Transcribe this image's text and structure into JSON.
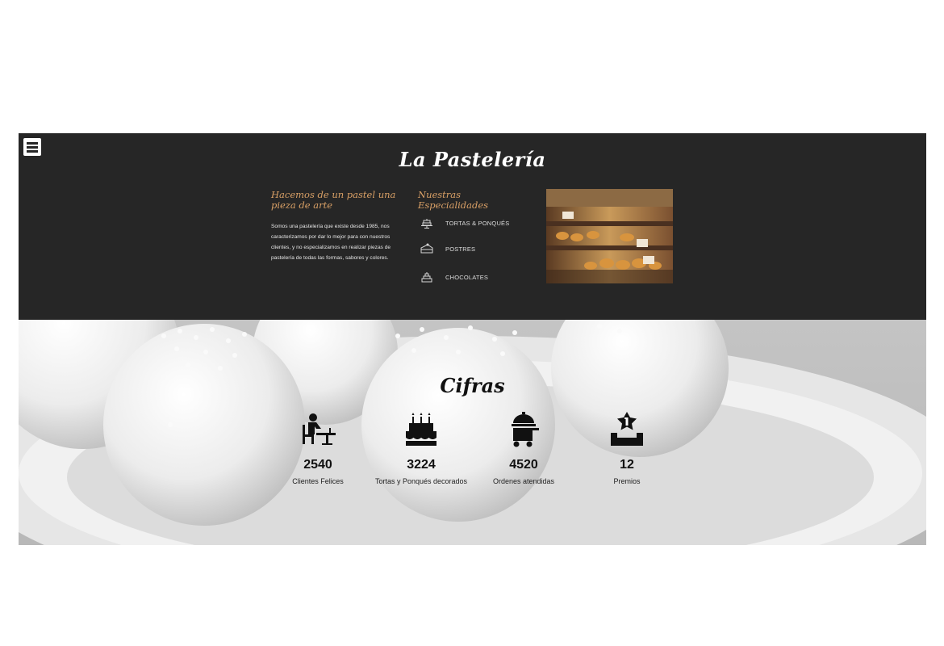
{
  "header": {
    "brand": "La Pastelería",
    "menu_icon": "hamburger-menu-icon"
  },
  "about": {
    "title": "Hacemos de un pastel una pieza de arte",
    "text": "Somos una pastelería que existe desde 1985, nos caracterizamos por dar lo mejor para con nuestros clientes, y no especializamos en realizar piezas de pastelería de todas las formas, sabores y colores."
  },
  "specialties": {
    "title": "Nuestras Especialidades",
    "items": [
      {
        "label": "TORTAS & PONQUÉS",
        "icon": "cake-stand-icon"
      },
      {
        "label": "POSTRES",
        "icon": "cake-slice-icon"
      },
      {
        "label": "CHOCOLATES",
        "icon": "layer-cake-icon"
      }
    ]
  },
  "photo": {
    "icon": "bakery-display-photo"
  },
  "stats": {
    "title": "Cifras",
    "items": [
      {
        "value": "2540",
        "label": "Clientes Felices",
        "icon": "customer-at-table-icon"
      },
      {
        "value": "3224",
        "label": "Tortas y Ponqués decorados",
        "icon": "birthday-cake-icon"
      },
      {
        "value": "4520",
        "label": "Ordenes atendidas",
        "icon": "room-service-cart-icon"
      },
      {
        "value": "12",
        "label": "Premios",
        "icon": "award-podium-icon"
      }
    ]
  },
  "colors": {
    "dark_bg": "#262626",
    "accent": "#d9a066",
    "hero_bg": "#d2d2d2"
  }
}
